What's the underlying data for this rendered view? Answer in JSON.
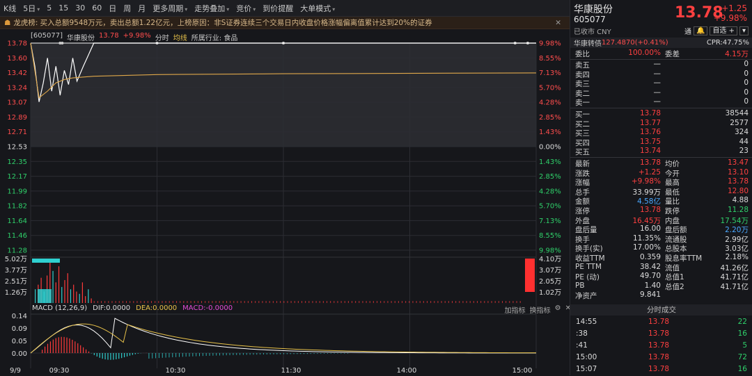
{
  "toolbar": {
    "items": [
      {
        "label": "K线"
      },
      {
        "label": "5日",
        "dropdown": true
      },
      {
        "label": "5"
      },
      {
        "label": "15"
      },
      {
        "label": "30"
      },
      {
        "label": "60"
      },
      {
        "label": "日"
      },
      {
        "label": "周"
      },
      {
        "label": "月"
      },
      {
        "label": "更多周期",
        "dropdown": true
      },
      {
        "label": "走势叠加",
        "dropdown": true
      },
      {
        "label": "竞价",
        "dropdown": true
      },
      {
        "label": "到价提醒"
      },
      {
        "label": "大单模式",
        "dropdown": true
      }
    ]
  },
  "dragon": {
    "title": "龙虎榜:",
    "text": "买入总额9548万元，卖出总额1.22亿元，上榜原因：非S证券连续三个交易日内收盘价格涨幅偏离值累计达到20%的证券"
  },
  "chart_info": {
    "code": "[605077]",
    "name": "华康股份",
    "price": "13.78",
    "change": "+9.98%",
    "mode": "分时",
    "avg_label": "均线",
    "industry": "所属行业: 食品"
  },
  "chart_data": {
    "type": "line",
    "title": "",
    "price_axis_left": [
      "13.78",
      "13.60",
      "13.42",
      "13.24",
      "13.07",
      "12.89",
      "12.71",
      "12.53",
      "12.35",
      "12.17",
      "11.99",
      "11.82",
      "11.64",
      "11.46",
      "11.28"
    ],
    "pct_axis_right": [
      "9.98%",
      "8.55%",
      "7.13%",
      "5.70%",
      "4.28%",
      "2.85%",
      "1.43%",
      "0.00%",
      "1.43%",
      "2.85%",
      "4.28%",
      "5.70%",
      "7.13%",
      "8.55%",
      "9.98%"
    ],
    "prev_close": 12.53,
    "ylim": [
      11.28,
      13.78
    ],
    "vol_axis_left": [
      "5.02万",
      "3.77万",
      "2.51万",
      "1.26万"
    ],
    "vol_axis_right": [
      "4.10万",
      "3.07万",
      "2.05万",
      "1.02万"
    ],
    "macd_axis": [
      "0.14",
      "0.09",
      "0.05",
      "0.00"
    ],
    "x_labels": [
      "9/9",
      "09:30",
      "10:30",
      "11:30",
      "14:00",
      "15:00"
    ],
    "series": [
      {
        "name": "价格",
        "x": [
          0,
          2,
          4,
          6,
          8,
          10,
          12,
          14,
          16,
          18,
          20,
          22,
          25,
          30,
          40,
          60,
          240
        ],
        "values": [
          13.78,
          13.5,
          13.07,
          13.3,
          13.6,
          13.2,
          13.5,
          13.15,
          13.45,
          13.28,
          13.6,
          13.32,
          13.5,
          13.78,
          13.78,
          13.78,
          13.78
        ]
      },
      {
        "name": "均线",
        "x": [
          0,
          4,
          8,
          12,
          16,
          20,
          30,
          60,
          120,
          240
        ],
        "values": [
          13.78,
          13.12,
          13.2,
          13.3,
          13.34,
          13.36,
          13.38,
          13.4,
          13.41,
          13.42
        ]
      }
    ]
  },
  "macd": {
    "label": "MACD (12,26,9)",
    "dif": "DIF:0.0000",
    "dea": "DEA:0.0000",
    "macd": "MACD:-0.0000",
    "tool1": "加指标",
    "tool2": "换指标"
  },
  "quote": {
    "name": "华康股份",
    "code": "605077",
    "status": "已收市 CNY",
    "price": "13.78",
    "change": "+1.25",
    "change_pct": "+9.98%",
    "btn_tong": "通",
    "btn_zixuan": "自选",
    "conv_label": "华康转债",
    "conv_value": "127.4870(+0.41%)",
    "cpr": "CPR:47.75%",
    "weibi": {
      "label": "委比",
      "value": "100.00%",
      "label2": "委差",
      "value2": "4.15万"
    },
    "sells": [
      {
        "label": "卖五",
        "price": "—",
        "vol": "0"
      },
      {
        "label": "卖四",
        "price": "—",
        "vol": "0"
      },
      {
        "label": "卖三",
        "price": "—",
        "vol": "0"
      },
      {
        "label": "卖二",
        "price": "—",
        "vol": "0"
      },
      {
        "label": "卖一",
        "price": "—",
        "vol": "0"
      }
    ],
    "buys": [
      {
        "label": "买一",
        "price": "13.78",
        "vol": "38544"
      },
      {
        "label": "买二",
        "price": "13.77",
        "vol": "2577"
      },
      {
        "label": "买三",
        "price": "13.76",
        "vol": "324"
      },
      {
        "label": "买四",
        "price": "13.75",
        "vol": "44"
      },
      {
        "label": "买五",
        "price": "13.74",
        "vol": "23"
      }
    ],
    "stats": [
      {
        "l1": "最新",
        "v1": "13.78",
        "c1": "red",
        "l2": "均价",
        "v2": "13.47",
        "c2": "red"
      },
      {
        "l1": "涨跌",
        "v1": "+1.25",
        "c1": "red",
        "l2": "今开",
        "v2": "13.10",
        "c2": "red"
      },
      {
        "l1": "涨幅",
        "v1": "+9.98%",
        "c1": "red",
        "l2": "最高",
        "v2": "13.78",
        "c2": "red"
      },
      {
        "l1": "总手",
        "v1": "33.99万",
        "c1": "wht",
        "l2": "最低",
        "v2": "12.80",
        "c2": "red"
      },
      {
        "l1": "金额",
        "v1": "4.58亿",
        "c1": "blu",
        "l2": "量比",
        "v2": "4.88",
        "c2": "wht"
      },
      {
        "l1": "涨停",
        "v1": "13.78",
        "c1": "red",
        "l2": "跌停",
        "v2": "11.28",
        "c2": "grn"
      },
      {
        "l1": "外盘",
        "v1": "16.45万",
        "c1": "red",
        "l2": "内盘",
        "v2": "17.54万",
        "c2": "grn"
      },
      {
        "l1": "盘后量",
        "v1": "16.00",
        "c1": "wht",
        "l2": "盘后额",
        "v2": "2.20万",
        "c2": "blu"
      },
      {
        "l1": "换手",
        "v1": "11.35%",
        "c1": "wht",
        "l2": "流通股",
        "v2": "2.99亿",
        "c2": "wht"
      },
      {
        "l1": "换手(实)",
        "v1": "17.00%",
        "c1": "wht",
        "l2": "总股本",
        "v2": "3.03亿",
        "c2": "wht"
      },
      {
        "l1": "收益TTM",
        "v1": "0.359",
        "c1": "wht",
        "l2": "股息率TTM",
        "v2": "2.18%",
        "c2": "wht"
      },
      {
        "l1": "PE TTM",
        "v1": "38.42",
        "c1": "wht",
        "l2": "流值",
        "v2": "41.26亿",
        "c2": "wht"
      },
      {
        "l1": "PE (动)",
        "v1": "49.70",
        "c1": "wht",
        "l2": "总值1",
        "v2": "41.71亿",
        "c2": "wht"
      },
      {
        "l1": "PB",
        "v1": "1.40",
        "c1": "wht",
        "l2": "总值2",
        "v2": "41.71亿",
        "c2": "wht"
      },
      {
        "l1": "净资产",
        "v1": "9.841",
        "c1": "wht",
        "l2": "",
        "v2": "",
        "c2": "wht"
      }
    ],
    "ticks_title": "分时成交",
    "ticks": [
      {
        "time": "14:55",
        "price": "13.78",
        "vol": "22"
      },
      {
        "time": ":38",
        "price": "13.78",
        "vol": "16"
      },
      {
        "time": ":41",
        "price": "13.78",
        "vol": "5"
      },
      {
        "time": "15:00",
        "price": "13.78",
        "vol": "72"
      },
      {
        "time": "15:07",
        "price": "13.78",
        "vol": "16"
      }
    ]
  }
}
